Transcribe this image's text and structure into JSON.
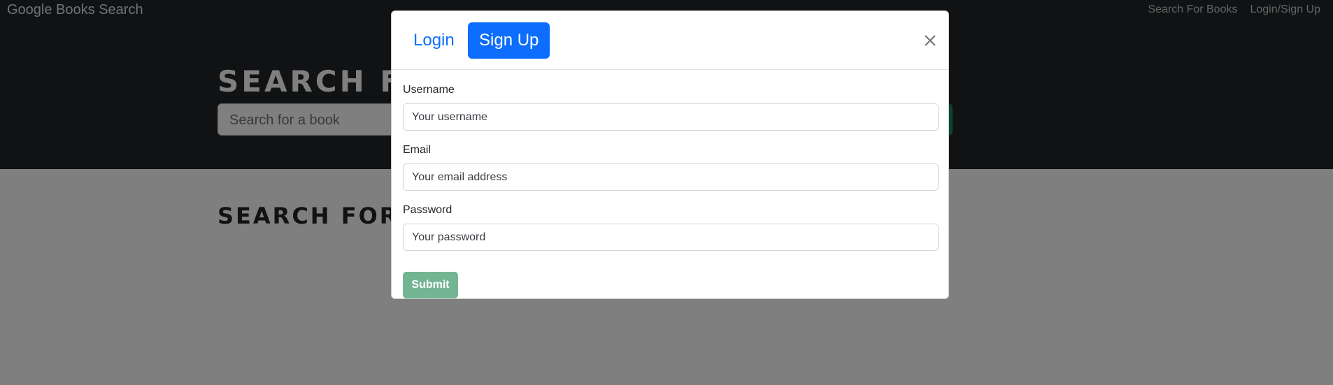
{
  "navbar": {
    "brand": "Google Books Search",
    "links": [
      "Search For Books",
      "Login/Sign Up"
    ]
  },
  "hero": {
    "title": "SEARCH FOR BOOKS!",
    "search_placeholder": "Search for a book"
  },
  "content": {
    "title": "SEARCH FOR A BOOK TO BEGIN"
  },
  "modal": {
    "tabs": [
      {
        "label": "Login",
        "active": false
      },
      {
        "label": "Sign Up",
        "active": true
      }
    ],
    "close_icon": "close-icon",
    "fields": [
      {
        "label": "Username",
        "placeholder": "Your username"
      },
      {
        "label": "Email",
        "placeholder": "Your email address"
      },
      {
        "label": "Password",
        "placeholder": "Your password"
      }
    ],
    "submit_label": "Submit"
  },
  "colors": {
    "primary": "#0d6efd",
    "dark": "#212529",
    "success_disabled": "#73b592"
  }
}
